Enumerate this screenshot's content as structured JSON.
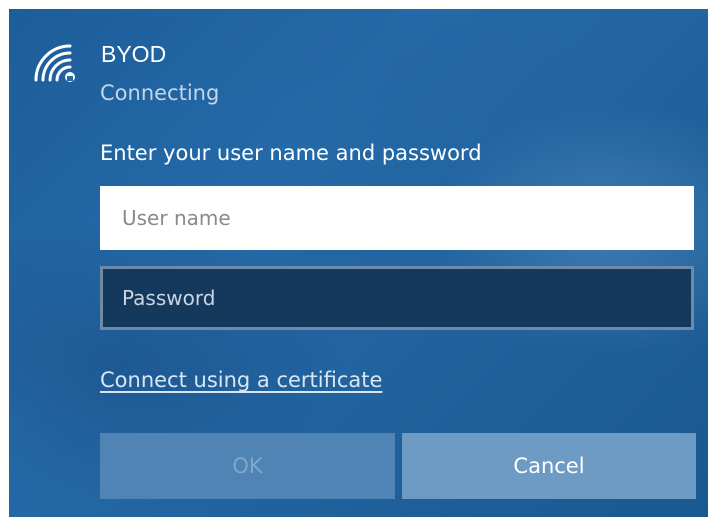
{
  "network": {
    "name": "BYOD",
    "status": "Connecting",
    "icon": "wifi-secured-icon"
  },
  "form": {
    "prompt": "Enter your user name and password",
    "username": {
      "value": "",
      "placeholder": "User name"
    },
    "password": {
      "value": "",
      "placeholder": "Password"
    },
    "certificate_link": "Connect using a certificate"
  },
  "buttons": {
    "ok_label": "OK",
    "ok_enabled": false,
    "cancel_label": "Cancel"
  },
  "colors": {
    "background": "#2469a8",
    "field_active_bg": "#ffffff",
    "field_inactive_bg": "#14395d",
    "ok_disabled_bg": "#4f84b4",
    "cancel_bg": "#6e9bc4"
  }
}
